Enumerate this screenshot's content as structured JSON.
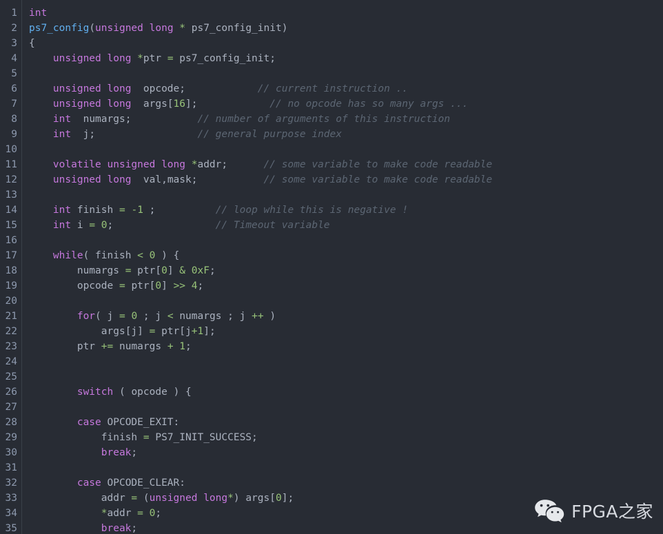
{
  "editor": {
    "language": "c",
    "background_color": "#282c34",
    "gutter_color": "#8d99ae",
    "first_line": 1,
    "last_line": 35
  },
  "colors": {
    "background": "#282c34",
    "foreground": "#abb2bf",
    "keyword": "#c678dd",
    "function": "#61afef",
    "number": "#98c379",
    "operator": "#56b6c2",
    "comment": "#5c6673",
    "gutter": "#8d99ae",
    "gutter_border": "#3a4049"
  },
  "line_numbers": [
    1,
    2,
    3,
    4,
    5,
    6,
    7,
    8,
    9,
    10,
    11,
    12,
    13,
    14,
    15,
    16,
    17,
    18,
    19,
    20,
    21,
    22,
    23,
    24,
    25,
    26,
    27,
    28,
    29,
    30,
    31,
    32,
    33,
    34,
    35
  ],
  "code_lines": [
    {
      "n": 1,
      "text": "int"
    },
    {
      "n": 2,
      "text": "ps7_config(unsigned long * ps7_config_init)"
    },
    {
      "n": 3,
      "text": "{"
    },
    {
      "n": 4,
      "text": "    unsigned long *ptr = ps7_config_init;"
    },
    {
      "n": 5,
      "text": ""
    },
    {
      "n": 6,
      "text": "    unsigned long  opcode;            // current instruction .."
    },
    {
      "n": 7,
      "text": "    unsigned long  args[16];            // no opcode has so many args ..."
    },
    {
      "n": 8,
      "text": "    int  numargs;           // number of arguments of this instruction"
    },
    {
      "n": 9,
      "text": "    int  j;                 // general purpose index"
    },
    {
      "n": 10,
      "text": ""
    },
    {
      "n": 11,
      "text": "    volatile unsigned long *addr;      // some variable to make code readable"
    },
    {
      "n": 12,
      "text": "    unsigned long  val,mask;           // some variable to make code readable"
    },
    {
      "n": 13,
      "text": ""
    },
    {
      "n": 14,
      "text": "    int finish = -1 ;          // loop while this is negative !"
    },
    {
      "n": 15,
      "text": "    int i = 0;                 // Timeout variable"
    },
    {
      "n": 16,
      "text": ""
    },
    {
      "n": 17,
      "text": "    while( finish < 0 ) {"
    },
    {
      "n": 18,
      "text": "        numargs = ptr[0] & 0xF;"
    },
    {
      "n": 19,
      "text": "        opcode = ptr[0] >> 4;"
    },
    {
      "n": 20,
      "text": ""
    },
    {
      "n": 21,
      "text": "        for( j = 0 ; j < numargs ; j ++ )"
    },
    {
      "n": 22,
      "text": "            args[j] = ptr[j+1];"
    },
    {
      "n": 23,
      "text": "        ptr += numargs + 1;"
    },
    {
      "n": 24,
      "text": ""
    },
    {
      "n": 25,
      "text": ""
    },
    {
      "n": 26,
      "text": "        switch ( opcode ) {"
    },
    {
      "n": 27,
      "text": ""
    },
    {
      "n": 28,
      "text": "        case OPCODE_EXIT:"
    },
    {
      "n": 29,
      "text": "            finish = PS7_INIT_SUCCESS;"
    },
    {
      "n": 30,
      "text": "            break;"
    },
    {
      "n": 31,
      "text": ""
    },
    {
      "n": 32,
      "text": "        case OPCODE_CLEAR:"
    },
    {
      "n": 33,
      "text": "            addr = (unsigned long*) args[0];"
    },
    {
      "n": 34,
      "text": "            *addr = 0;"
    },
    {
      "n": 35,
      "text": "            break;"
    }
  ],
  "watermark": {
    "icon": "wechat-icon",
    "text": "FPGA之家",
    "text_color": "#d7dae0"
  }
}
